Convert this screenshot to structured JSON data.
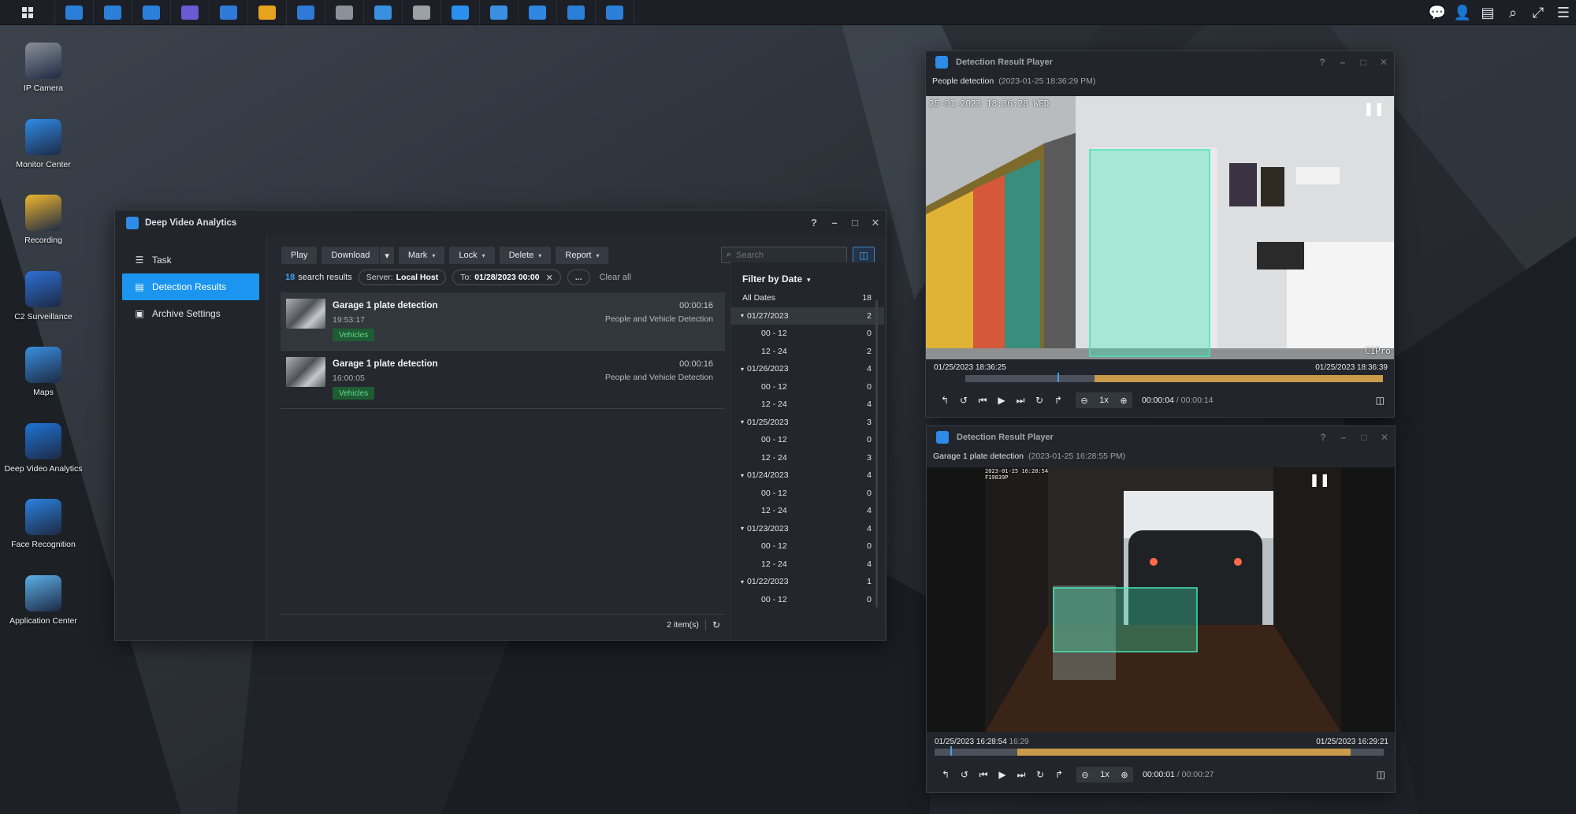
{
  "taskbar": {
    "apps": [
      {
        "icon": "surveillance-icon",
        "color": "#2b7fd9"
      },
      {
        "icon": "surveillance-icon",
        "color": "#2b7fd9"
      },
      {
        "icon": "surveillance-icon",
        "color": "#2b7fd9"
      },
      {
        "icon": "deep-video-icon",
        "color": "#6a5ad3"
      },
      {
        "icon": "face-icon",
        "color": "#2f7ad8"
      },
      {
        "icon": "recording-icon",
        "color": "#e7a21e"
      },
      {
        "icon": "calendar-icon",
        "color": "#2f7ad8"
      },
      {
        "icon": "camera-icon",
        "color": "#8b9198"
      },
      {
        "icon": "monitor-icon",
        "color": "#3a8fe0"
      },
      {
        "icon": "camera-settings-icon",
        "color": "#9aa0a6"
      },
      {
        "icon": "home-mode-icon",
        "color": "#2b8ff0"
      },
      {
        "icon": "search-camera-icon",
        "color": "#3a8fe0"
      },
      {
        "icon": "analytics-icon",
        "color": "#2e86e0"
      },
      {
        "icon": "surveillance-icon",
        "color": "#2b7fd9"
      },
      {
        "icon": "surveillance-icon",
        "color": "#2b7fd9"
      }
    ]
  },
  "desktop_icons": [
    {
      "label": "IP Camera",
      "icon": "ip-camera-icon",
      "color": "#8a9098"
    },
    {
      "label": "Monitor Center",
      "icon": "monitor-center-icon",
      "color": "#2f8be8"
    },
    {
      "label": "Recording",
      "icon": "recording-icon",
      "color": "#f0b62e"
    },
    {
      "label": "C2 Surveillance",
      "icon": "c2-surveillance-icon",
      "color": "#2d6fd6"
    },
    {
      "label": "Maps",
      "icon": "maps-icon",
      "color": "#3a8fe0"
    },
    {
      "label": "Deep Video Analytics",
      "icon": "deep-video-analytics-icon",
      "color": "#1f74d8"
    },
    {
      "label": "Face Recognition",
      "icon": "face-recognition-icon",
      "color": "#2b82e0"
    },
    {
      "label": "Application Center",
      "icon": "application-center-icon",
      "color": "#5bb0e8"
    }
  ],
  "dva": {
    "title": "Deep Video Analytics",
    "sidebar": [
      {
        "label": "Task",
        "icon": "list-icon"
      },
      {
        "label": "Detection Results",
        "icon": "document-icon"
      },
      {
        "label": "Archive Settings",
        "icon": "archive-icon"
      }
    ],
    "toolbar": {
      "play": "Play",
      "download": "Download",
      "mark": "Mark",
      "lock": "Lock",
      "delete": "Delete",
      "report": "Report"
    },
    "search_placeholder": "Search",
    "summary": {
      "count": "18",
      "count_label": "search results",
      "server_label": "Server:",
      "server_value": "Local Host",
      "to_label": "To:",
      "to_value": "01/28/2023 00:00",
      "more": "...",
      "clear_all": "Clear all"
    },
    "results": [
      {
        "title": "Garage 1 plate detection",
        "time": "19:53:17",
        "tag": "Vehicles",
        "duration": "00:00:16",
        "type": "People and Vehicle Detection"
      },
      {
        "title": "Garage 1 plate detection",
        "time": "16:00:05",
        "tag": "Vehicles",
        "duration": "00:00:16",
        "type": "People and Vehicle Detection"
      }
    ],
    "footer_count": "2 item(s)",
    "filter": {
      "title": "Filter by Date",
      "rows": [
        {
          "label": "All Dates",
          "count": "18",
          "level": 0
        },
        {
          "label": "01/27/2023",
          "count": "2",
          "level": 1
        },
        {
          "label": "00 - 12",
          "count": "0",
          "level": 2
        },
        {
          "label": "12 - 24",
          "count": "2",
          "level": 2
        },
        {
          "label": "01/26/2023",
          "count": "4",
          "level": 1
        },
        {
          "label": "00 - 12",
          "count": "0",
          "level": 2
        },
        {
          "label": "12 - 24",
          "count": "4",
          "level": 2
        },
        {
          "label": "01/25/2023",
          "count": "3",
          "level": 1
        },
        {
          "label": "00 - 12",
          "count": "0",
          "level": 2
        },
        {
          "label": "12 - 24",
          "count": "3",
          "level": 2
        },
        {
          "label": "01/24/2023",
          "count": "4",
          "level": 1
        },
        {
          "label": "00 - 12",
          "count": "0",
          "level": 2
        },
        {
          "label": "12 - 24",
          "count": "4",
          "level": 2
        },
        {
          "label": "01/23/2023",
          "count": "4",
          "level": 1
        },
        {
          "label": "00 - 12",
          "count": "0",
          "level": 2
        },
        {
          "label": "12 - 24",
          "count": "4",
          "level": 2
        },
        {
          "label": "01/22/2023",
          "count": "1",
          "level": 1
        },
        {
          "label": "00 - 12",
          "count": "0",
          "level": 2
        }
      ]
    }
  },
  "player1": {
    "title": "Detection Result Player",
    "subtitle": "People detection",
    "subtitle_time": "(2023-01-25 18:36:29 PM)",
    "osd_time": "25-01-2023 18:36:28 WED",
    "osd_brand": "C1Pro",
    "start": "01/25/2023 18:36:25",
    "end": "01/25/2023 18:36:39",
    "progress": 0.22,
    "speed": "1x",
    "current": "00:00:04",
    "total": "00:00:14"
  },
  "player2": {
    "title": "Detection Result Player",
    "subtitle": "Garage 1 plate detection",
    "subtitle_time": "(2023-01-25 16:28:55 PM)",
    "osd_time": "2023-01-25 16:28:54",
    "osd_plate": "F19839P",
    "start": "01/25/2023 16:28:54",
    "hover_time": "16:29",
    "end": "01/25/2023 16:29:21",
    "progress": 0.035,
    "speed": "1x",
    "current": "00:00:01",
    "total": "00:00:27"
  }
}
